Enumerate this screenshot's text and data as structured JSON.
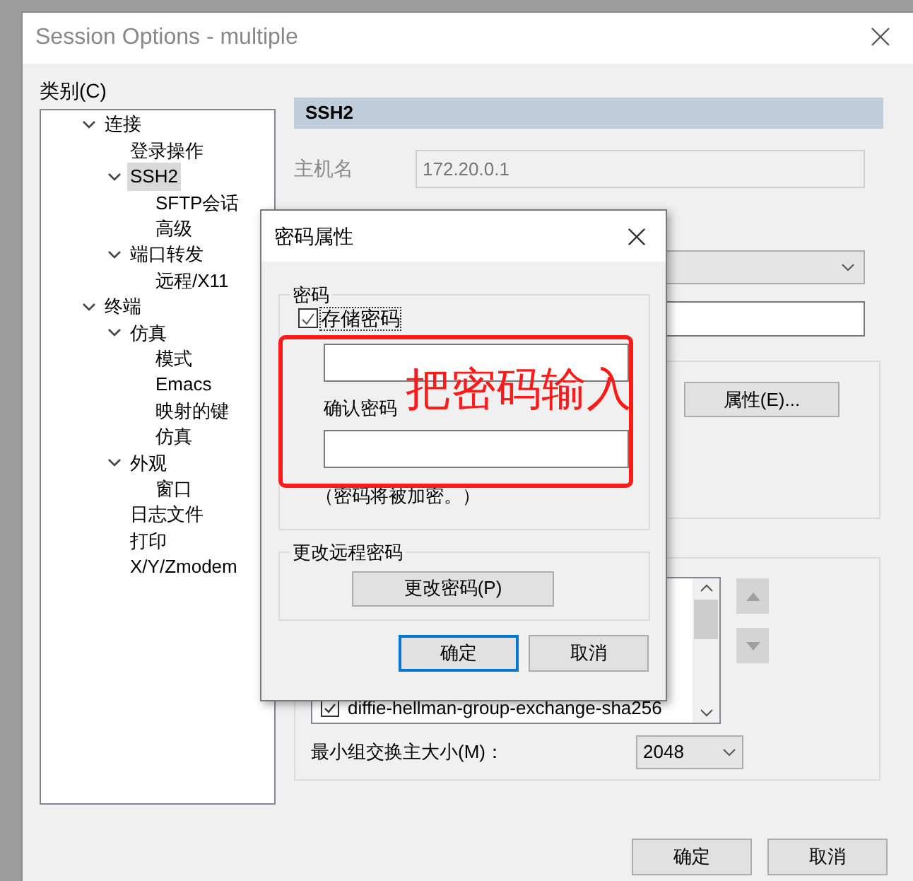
{
  "window": {
    "title": "Session Options - multiple"
  },
  "category_label": "类别(C)",
  "tree": [
    {
      "label": "连接",
      "expanded": true,
      "selected": false,
      "children": [
        {
          "label": "登录操作",
          "selected": false
        },
        {
          "label": "SSH2",
          "expanded": true,
          "selected": true,
          "children": [
            {
              "label": "SFTP会话",
              "selected": false
            },
            {
              "label": "高级",
              "selected": false
            }
          ]
        },
        {
          "label": "端口转发",
          "expanded": true,
          "selected": false,
          "children": [
            {
              "label": "远程/X11",
              "selected": false
            }
          ]
        }
      ]
    },
    {
      "label": "终端",
      "expanded": true,
      "selected": false,
      "children": [
        {
          "label": "仿真",
          "expanded": true,
          "selected": false,
          "children": [
            {
              "label": "模式",
              "selected": false
            },
            {
              "label": "Emacs",
              "selected": false
            },
            {
              "label": "映射的键",
              "selected": false
            },
            {
              "label": "仿真",
              "selected": false
            }
          ]
        },
        {
          "label": "外观",
          "expanded": true,
          "selected": false,
          "children": [
            {
              "label": "窗口",
              "selected": false
            }
          ]
        },
        {
          "label": "日志文件",
          "selected": false
        },
        {
          "label": "打印",
          "selected": false
        },
        {
          "label": "X/Y/Zmodem",
          "selected": false
        }
      ]
    }
  ],
  "panel": {
    "header": "SSH2",
    "hostname_label": "主机名",
    "hostname_value": "172.20.0.1",
    "properties_button": "属性(E)...",
    "kex_items": [
      {
        "label": "diffie-hellman-group-exchange-sha256",
        "checked": true
      }
    ],
    "min_group_label": "最小组交换主大小(M)：",
    "min_group_value": "2048"
  },
  "buttons": [
    {
      "label": "确定"
    },
    {
      "label": "取消"
    }
  ],
  "dialog": {
    "title": "密码属性",
    "password_group": "密码",
    "store_password": {
      "label": "存储密码",
      "checked": true
    },
    "confirm_label": "确认密码",
    "note": "（密码将被加密。）",
    "remote_group": "更改远程密码",
    "change_button": "更改密码(P)",
    "buttons": [
      {
        "label": "确定",
        "default": true
      },
      {
        "label": "取消",
        "default": false
      }
    ]
  },
  "annotation": {
    "text": "把密码输入"
  }
}
